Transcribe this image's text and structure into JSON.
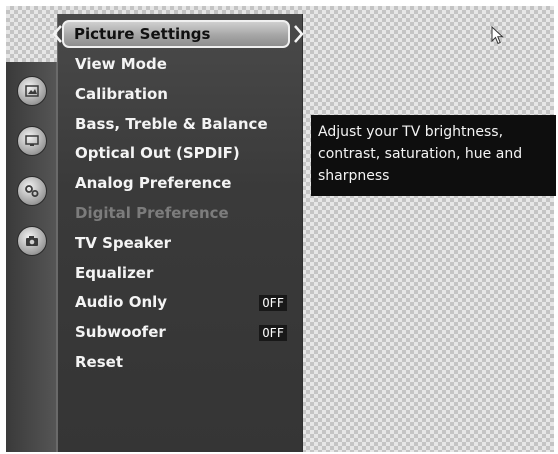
{
  "menu": {
    "header": "Picture Settings",
    "items": [
      {
        "label": "View Mode",
        "enabled": true
      },
      {
        "label": "Calibration",
        "enabled": true
      },
      {
        "label": "Bass, Treble & Balance",
        "enabled": true
      },
      {
        "label": "Optical Out (SPDIF)",
        "enabled": true
      },
      {
        "label": "Analog Preference",
        "enabled": true
      },
      {
        "label": "Digital Preference",
        "enabled": false
      },
      {
        "label": "TV Speaker",
        "enabled": true
      },
      {
        "label": "Equalizer",
        "enabled": true
      },
      {
        "label": "Audio Only",
        "enabled": true,
        "value": "OFF"
      },
      {
        "label": "Subwoofer",
        "enabled": true,
        "value": "OFF"
      },
      {
        "label": "Reset",
        "enabled": true
      }
    ]
  },
  "tooltip": {
    "text": "Adjust your TV brightness, contrast, saturation, hue and sharpness"
  },
  "sidebar": {
    "icons": [
      "picture-icon",
      "tv-icon",
      "gear-icon",
      "camera-icon"
    ]
  },
  "colors": {
    "panel": "#3a3a3a",
    "header": "#a6a6a6",
    "text": "#f4f4f4",
    "disabled_text": "#7c7c7c",
    "tooltip_bg": "#0e0e0e"
  }
}
